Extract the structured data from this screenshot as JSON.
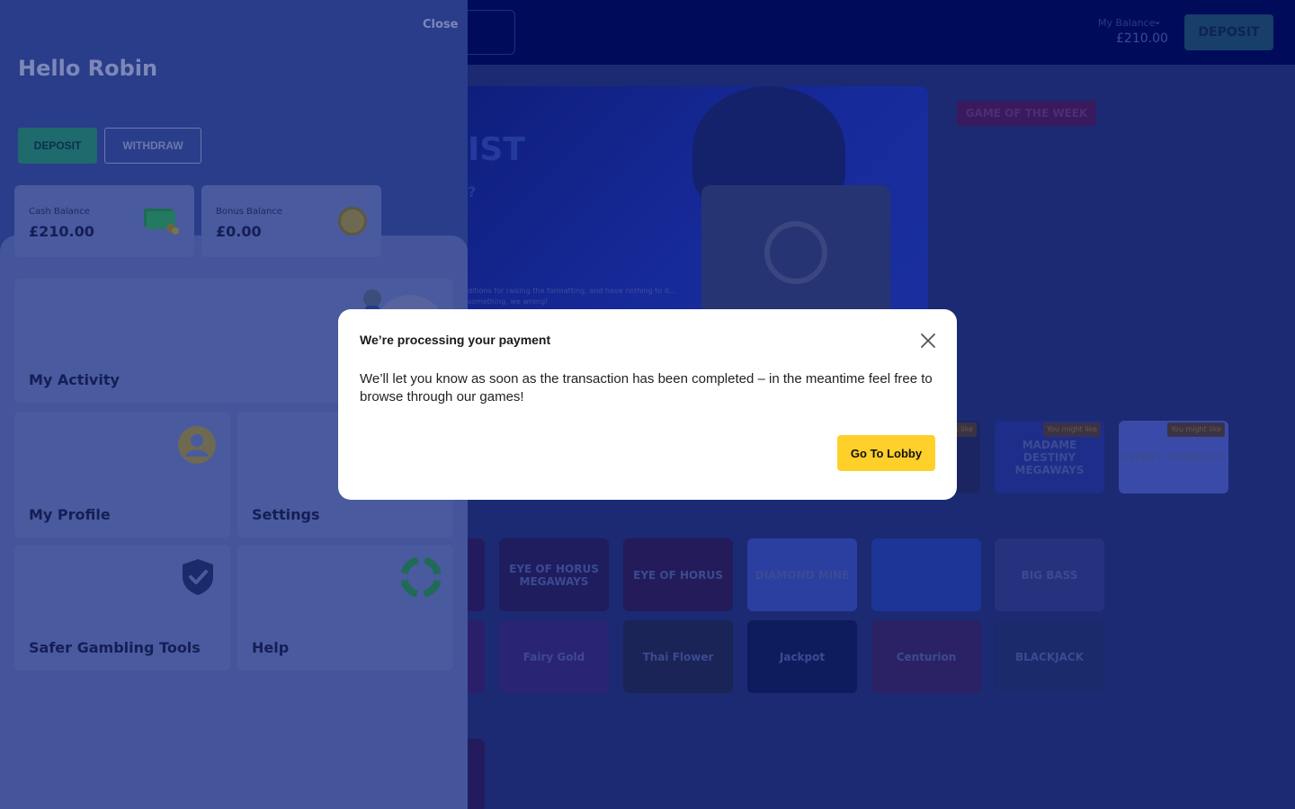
{
  "header": {
    "balance_label": "My Balance",
    "balance_value": "£210.00",
    "deposit_label": "DEPOSIT"
  },
  "hero": {
    "title": "IST",
    "subtitle": "?",
    "small_print": "ditions for raising the formatting, and have nothing to it... something, we wrong!"
  },
  "game_of_week": {
    "label": "GAME OF THE WEEK"
  },
  "recommended": {
    "tag": "You might like",
    "games": [
      "",
      "MADAME DESTINY MEGAWAYS",
      "SWEET BONANZA"
    ]
  },
  "games_row1": [
    "",
    "EYE OF HORUS MEGAWAYS",
    "EYE OF HORUS",
    "DIAMOND MINE",
    "",
    "BIG BASS"
  ],
  "games_row2": [
    "",
    "Fairy Gold",
    "Thai Flower",
    "Jackpot",
    "Centurion",
    "BLACKJACK"
  ],
  "drawer": {
    "close_label": "Close",
    "greeting": "Hello Robin",
    "deposit_label": "DEPOSIT",
    "withdraw_label": "WITHDRAW",
    "cash_balance_label": "Cash Balance",
    "cash_balance_value": "£210.00",
    "bonus_balance_label": "Bonus Balance",
    "bonus_balance_value": "£0.00",
    "menu": {
      "activity": "My Activity",
      "profile": "My Profile",
      "settings": "Settings",
      "safer": "Safer Gambling Tools",
      "help": "Help"
    }
  },
  "modal": {
    "title": "We’re processing your payment",
    "body": "We’ll let you know as soon as the transaction has been completed – in the meantime feel free to browse through our games!",
    "button_label": "Go To Lobby"
  }
}
